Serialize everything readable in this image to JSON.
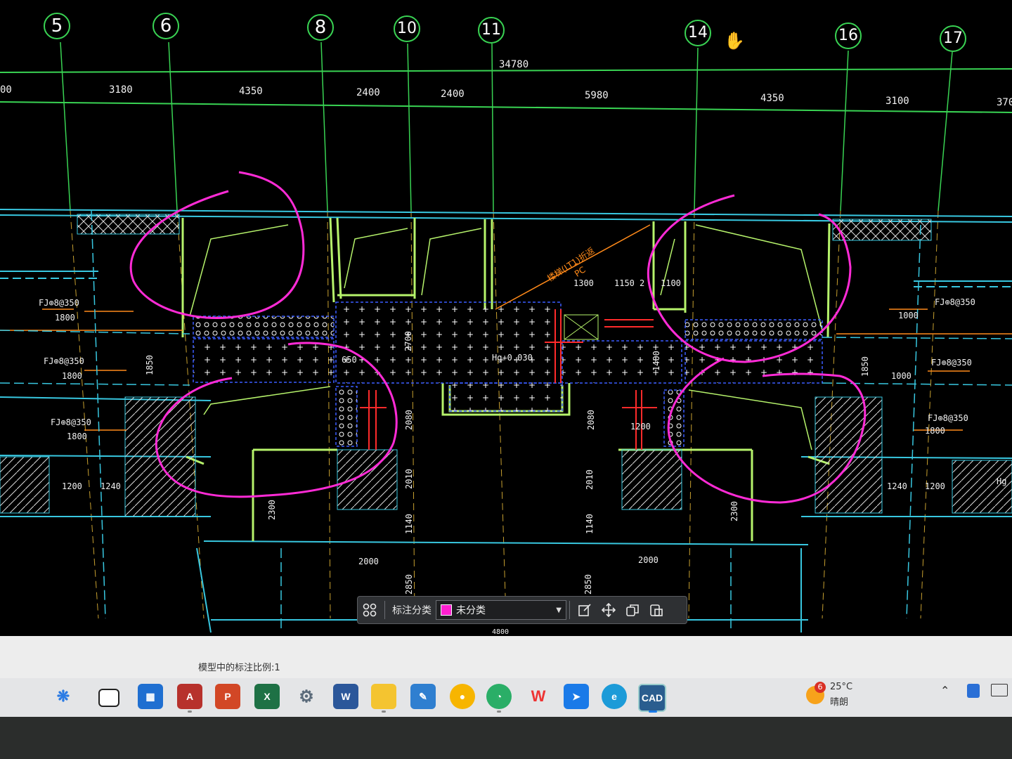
{
  "axes": [
    {
      "label": "5"
    },
    {
      "label": "6"
    },
    {
      "label": "8"
    },
    {
      "label": "10"
    },
    {
      "label": "11"
    },
    {
      "label": "14"
    },
    {
      "label": "16"
    },
    {
      "label": "17"
    }
  ],
  "dims_top": {
    "total": "34780",
    "spans": [
      "00",
      "3180",
      "4350",
      "2400",
      "2400",
      "5980",
      "4350",
      "3100",
      "370"
    ]
  },
  "dims_inner": {
    "d1300": "1300",
    "d1150": "1150",
    "d2": "2",
    "d1100": "1100",
    "d1800a": "1800",
    "d1800b": "1800",
    "d1800c": "1800",
    "d1000a": "1000",
    "d1000b": "1000",
    "d1800r": "1800",
    "d1850l": "1850",
    "d1850r": "1850",
    "d1200l": "1200",
    "d1240l": "1240",
    "d1240r": "1240",
    "d1200r": "1200",
    "d2300l": "2300",
    "d2300r": "2300",
    "d2000l": "2000",
    "d2000r": "2000",
    "d2080l": "2080",
    "d2080r": "2080",
    "d2010l": "2010",
    "d2010r": "2010",
    "d1140l": "1140",
    "d1140r": "1140",
    "d2850l": "2850",
    "d2850r": "2850",
    "d2700": "2700",
    "d1400": "1400",
    "d650": "650",
    "d1200m": "1200",
    "d4800": "4800"
  },
  "notes": {
    "fj1": "FJ⊕8@350",
    "fj2": "FJ⊕8@350",
    "fj3": "FJ⊕8@350",
    "fj4": "FJ⊕8@350",
    "fj5": "FJ⊕8@350",
    "fj6": "FJ⊕8@350",
    "level": "Hg+0.030",
    "level_r": "Hg",
    "diag": "楼梯(LT1)折返",
    "diag2": "PC"
  },
  "toolbar": {
    "label": "标注分类",
    "selected": "未分类",
    "icons": [
      "grid-icon",
      "edit-icon",
      "move-icon",
      "copy-icon",
      "paste-icon"
    ]
  },
  "status": {
    "text": "模型中的标注比例:1"
  },
  "taskbar": {
    "apps": [
      "start",
      "desktop",
      "store",
      "access",
      "powerpoint",
      "excel",
      "settings",
      "word",
      "explorer",
      "notepad",
      "sun",
      "wechat",
      "wps",
      "dingtalk",
      "edge",
      "cad"
    ],
    "weather": {
      "badge": "6",
      "temp": "25°C",
      "desc": "晴朗"
    }
  },
  "colors": {
    "axis": "#39d353",
    "wall": "#b6f36b",
    "cyan": "#38c7e0",
    "orange": "#ff8a1a",
    "magenta": "#ff2bd6",
    "red": "#ff2b2b"
  }
}
